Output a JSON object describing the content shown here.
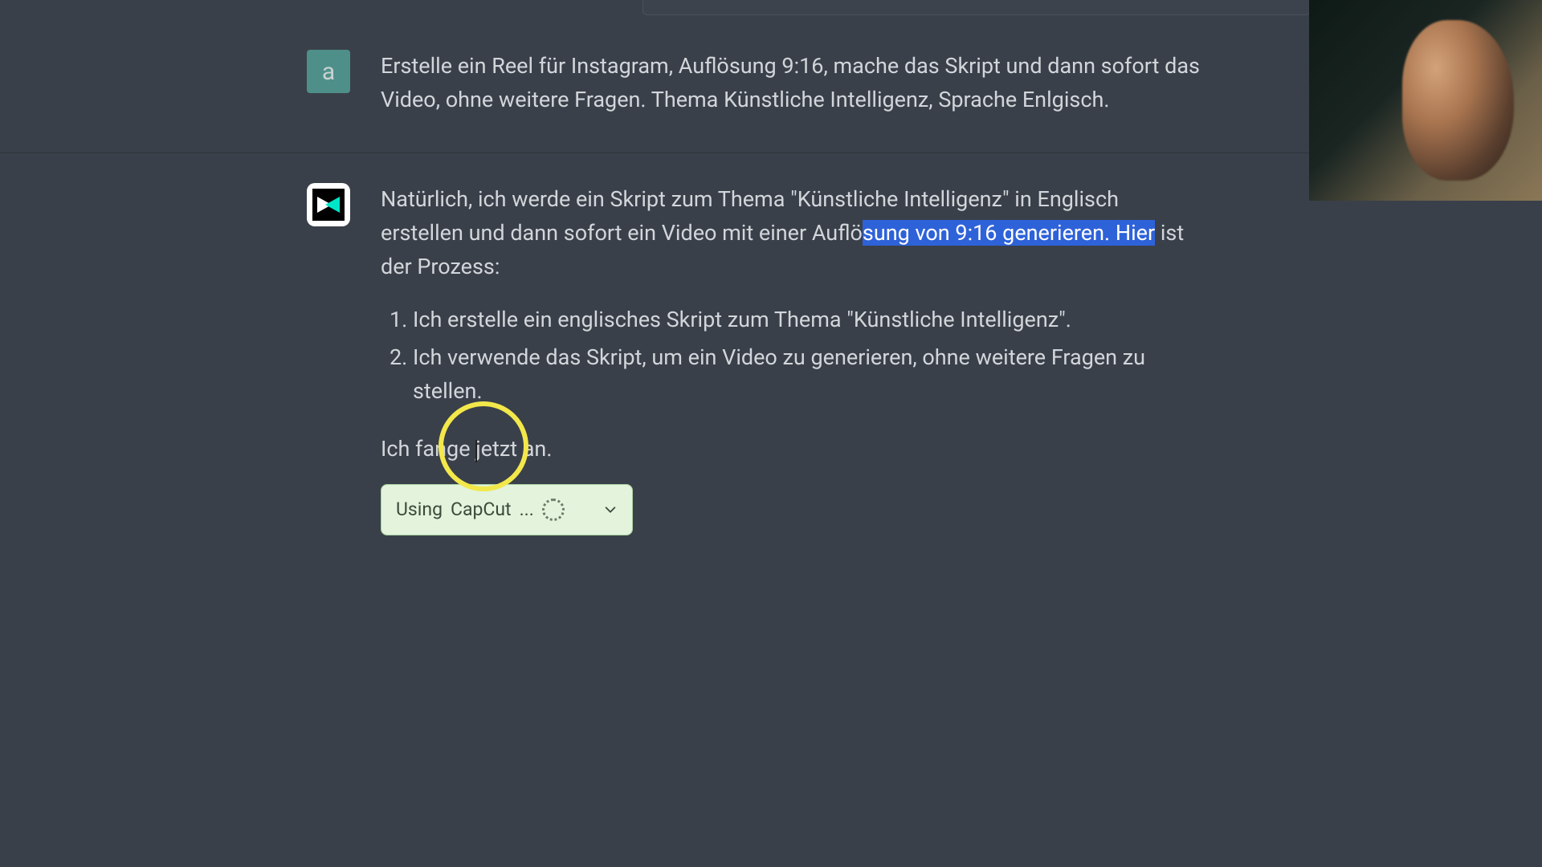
{
  "user": {
    "avatar_letter": "a",
    "message": "Erstelle ein Reel für Instagram, Auflösung 9:16, mache das Skript und dann sofort das Video, ohne weitere Fragen. Thema Künstliche Intelligenz, Sprache Enlgisch."
  },
  "bot": {
    "intro_pre": "Natürlich, ich werde ein Skript zum Thema \"Künstliche Intelligenz\" in Englisch erstellen und dann sofort ein Video mit einer Auflö",
    "intro_sel": "sung von 9:16 generieren. Hier",
    "intro_post": " ist der Prozess:",
    "steps": [
      "Ich erstelle ein englisches Skript zum Thema \"Künstliche Intelligenz\".",
      "Ich verwende das Skript, um ein Video zu generieren, ohne weitere Fragen zu stellen."
    ],
    "start": "Ich fange jetzt an."
  },
  "plugin": {
    "label_pre": "Using ",
    "label_tool": "CapCut",
    "label_post": "..."
  }
}
